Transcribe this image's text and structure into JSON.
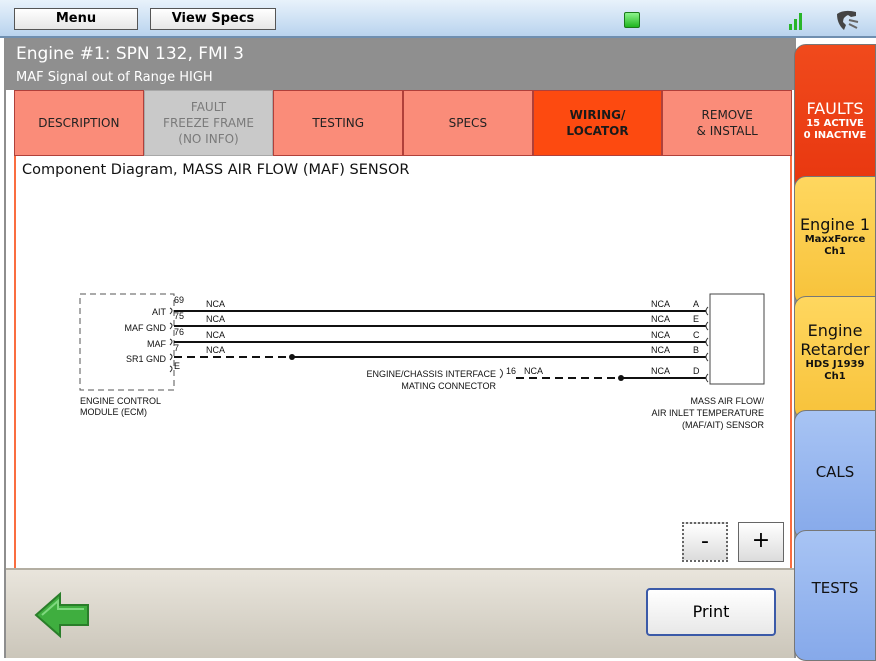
{
  "topbar": {
    "menu_label": "Menu",
    "viewspecs_label": "View Specs"
  },
  "header": {
    "title": "Engine #1: SPN 132, FMI 3",
    "subtitle": "MAF Signal out of Range HIGH"
  },
  "tabs": [
    {
      "label": "DESCRIPTION"
    },
    {
      "label": "FAULT\nFREEZE FRAME\n(NO INFO)"
    },
    {
      "label": "TESTING"
    },
    {
      "label": "SPECS"
    },
    {
      "label": "WIRING/\nLOCATOR"
    },
    {
      "label": "REMOVE\n& INSTALL"
    }
  ],
  "content": {
    "title": "Component Diagram, MASS AIR FLOW (MAF) SENSOR"
  },
  "diagram": {
    "ecm_label_1": "ENGINE CONTROL",
    "ecm_label_2": "MODULE (ECM)",
    "sensor_label_1": "MASS AIR FLOW/",
    "sensor_label_2": "AIR INLET TEMPERATURE",
    "sensor_label_3": "(MAF/AIT) SENSOR",
    "connector_label_1": "ENGINE/CHASSIS INTERFACE",
    "connector_label_2": "MATING CONNECTOR",
    "connector_pin": "16",
    "connector_nca": "NCA",
    "wires": [
      {
        "name": "AIT",
        "ecm_pin": "69",
        "nca_left": "NCA",
        "nca_right": "NCA",
        "sensor_pin": "A"
      },
      {
        "name": "MAF GND",
        "ecm_pin": "75",
        "nca_left": "NCA",
        "nca_right": "NCA",
        "sensor_pin": "E"
      },
      {
        "name": "MAF",
        "ecm_pin": "76",
        "nca_left": "NCA",
        "nca_right": "NCA",
        "sensor_pin": "C"
      },
      {
        "name": "SR1 GND",
        "ecm_pin": "7",
        "nca_left": "NCA",
        "nca_right": "NCA",
        "sensor_pin": "B"
      },
      {
        "name": "",
        "ecm_pin": "E",
        "nca_left": "",
        "nca_right": "NCA",
        "sensor_pin": "D"
      }
    ]
  },
  "zoom": {
    "minus": "-",
    "plus": "+"
  },
  "footer": {
    "print_label": "Print"
  },
  "sidetabs": {
    "faults": {
      "title": "FAULTS",
      "line1": "15 ACTIVE",
      "line2": "0 INACTIVE"
    },
    "engine1": {
      "title": "Engine 1",
      "line1": "MaxxForce",
      "line2": "Ch1"
    },
    "retarder": {
      "title1": "Engine",
      "title2": "Retarder",
      "line1": "HDS J1939",
      "line2": "Ch1"
    },
    "cals": {
      "title": "CALS"
    },
    "tests": {
      "title": "TESTS"
    }
  },
  "colors": {
    "tab": "#fa8c79",
    "tab_active": "#fd4a10",
    "faults_tab": "#e8360f",
    "engine_tab": "#f7c23a",
    "blue_tab": "#86a9ea"
  },
  "icons": {
    "back": "back-arrow-icon",
    "signal": "signal-bars-icon",
    "status": "connection-status-icon",
    "phone": "phone-icon"
  }
}
